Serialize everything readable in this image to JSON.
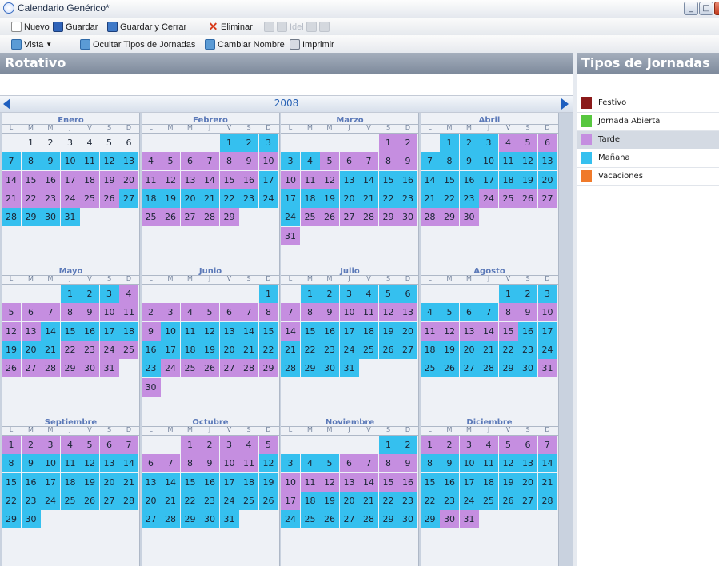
{
  "window": {
    "title": "Calendario Genérico*"
  },
  "toolbar1": {
    "nuevo": "Nuevo",
    "guardar": "Guardar",
    "guardar_cerrar": "Guardar y Cerrar",
    "eliminar": "Eliminar",
    "disabled_text": "Idel"
  },
  "toolbar2": {
    "vista": "Vista",
    "ocultar": "Ocultar Tipos de Jornadas",
    "cambiar": "Cambiar Nombre",
    "imprimir": "Imprimir"
  },
  "calendar": {
    "title": "Rotativo",
    "year": "2008",
    "weekdays": [
      "L",
      "M",
      "M",
      "J",
      "V",
      "S",
      "D"
    ]
  },
  "months": [
    {
      "name": "Enero",
      "offset": 1,
      "days": 31,
      "pattern": "NNNNNNMMMMMMMTTTTTTTTTTTTTMMMMM"
    },
    {
      "name": "Febrero",
      "offset": 4,
      "days": 29,
      "pattern": "MMMTTTTTTTTTTTTTMMMMMMMMTTTTT"
    },
    {
      "name": "Marzo",
      "offset": 5,
      "days": 31,
      "pattern": "TTMMTTTTTTTTMMMMMMMMMMMMTTTTTTT"
    },
    {
      "name": "Abril",
      "offset": 1,
      "days": 30,
      "pattern": "MMMTTTMMMMMMMMMMMMMMMMMTTTTTTTT"
    },
    {
      "name": "Mayo",
      "offset": 3,
      "days": 31,
      "pattern": "MMMTTTTTTTTTTMMMMMMMMTTTTTTTTTT"
    },
    {
      "name": "Junio",
      "offset": 6,
      "days": 30,
      "pattern": "MTTTTTTTTMMMMMMMMMMMMMMTTTTTTTT"
    },
    {
      "name": "Julio",
      "offset": 1,
      "days": 31,
      "pattern": "MMMMMMTTTTTTTTMMMMMMMMMMMMMMMMM"
    },
    {
      "name": "Agosto",
      "offset": 4,
      "days": 31,
      "pattern": "MMMMMMMTTTTTTTTMMMMMMMMMMMMMMMT"
    },
    {
      "name": "Septiembre",
      "offset": 0,
      "days": 30,
      "pattern": "TTTTTTTMMMMMMMMMMMMMMMMMMMMMMM"
    },
    {
      "name": "Octubre",
      "offset": 2,
      "days": 31,
      "pattern": "TTTTTTTTTTTMMMMMMMMMMMMMMMMMMMM"
    },
    {
      "name": "Noviembre",
      "offset": 5,
      "days": 30,
      "pattern": "MMMMMTTTTTTTTTTTTMMMMMMMMMMMMM"
    },
    {
      "name": "Diciembre",
      "offset": 0,
      "days": 31,
      "pattern": "TTTTTTTMMMMMMMMMMMMMMMMMMMMMMTT"
    }
  ],
  "legend": {
    "title": "Tipos de Jornadas",
    "items": [
      {
        "label": "Festivo",
        "color": "#8b1a1a"
      },
      {
        "label": "Jornada Abierta",
        "color": "#57c73f"
      },
      {
        "label": "Tarde",
        "color": "#c58ee0",
        "selected": true
      },
      {
        "label": "Mañana",
        "color": "#35c0ef"
      },
      {
        "label": "Vacaciones",
        "color": "#f07a2a"
      }
    ]
  },
  "colors": {
    "tarde": "#c58ee0",
    "manana": "#35c0ef"
  }
}
